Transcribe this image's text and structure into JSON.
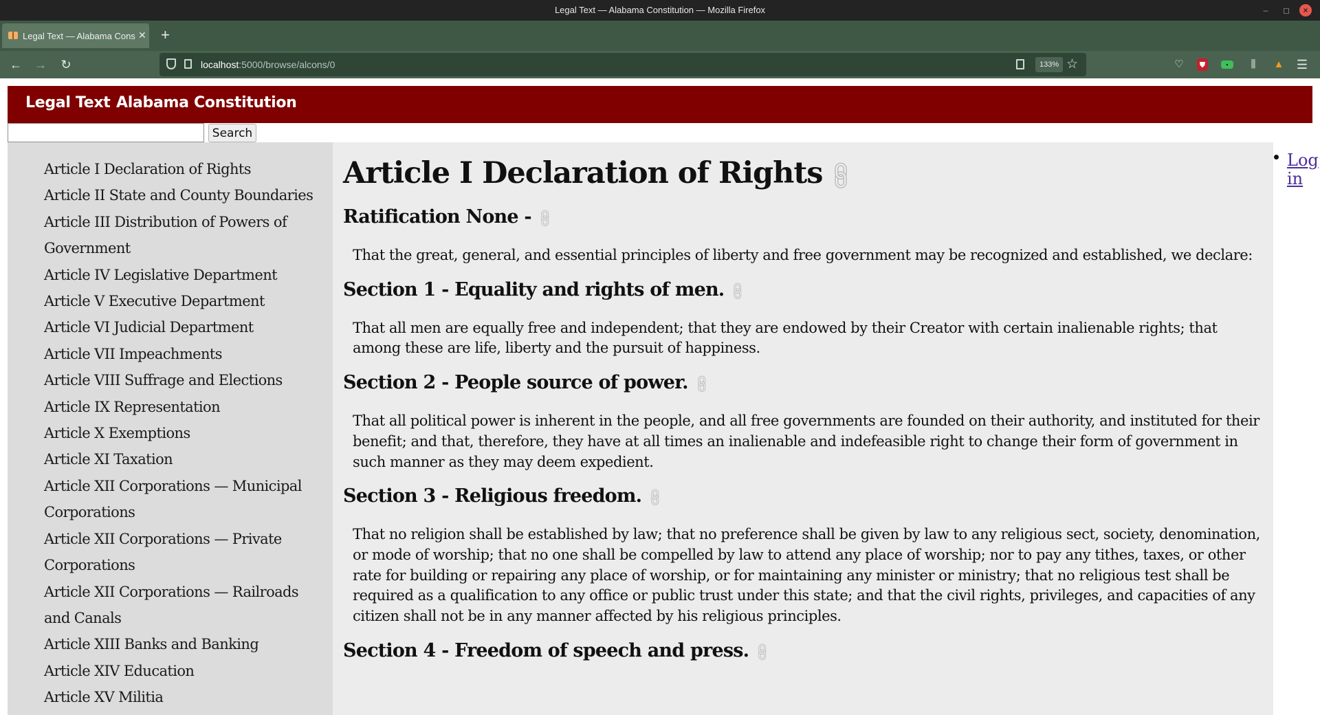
{
  "window": {
    "title": "Legal Text — Alabama Constitution — Mozilla Firefox"
  },
  "tab": {
    "label": "Legal Text — Alabama Cons"
  },
  "urlbar": {
    "host": "localhost",
    "path": ":5000/browse/alcons/0",
    "zoom": "133%"
  },
  "header": {
    "brand": "Legal Text",
    "title": "Alabama Constitution"
  },
  "search": {
    "value": "",
    "button_label": "Search"
  },
  "sidebar": {
    "items": [
      "Article I Declaration of Rights",
      "Article II State and County Boundaries",
      "Article III Distribution of Powers of Government",
      "Article IV Legislative Department",
      "Article V Executive Department",
      "Article VI Judicial Department",
      "Article VII Impeachments",
      "Article VIII Suffrage and Elections",
      "Article IX Representation",
      "Article X Exemptions",
      "Article XI Taxation",
      "Article XII Corporations — Municipal Corporations",
      "Article XII Corporations — Private Corporations",
      "Article XII Corporations — Railroads and Canals",
      "Article XIII Banks and Banking",
      "Article XIV Education",
      "Article XV Militia"
    ]
  },
  "main": {
    "heading": "Article I Declaration of Rights",
    "sections": [
      {
        "title": "Ratification None -",
        "body": "That the great, general, and essential principles of liberty and free government may be recognized and established, we declare:"
      },
      {
        "title": "Section 1 - Equality and rights of men.",
        "body": "That all men are equally free and independent; that they are endowed by their Creator with certain inalienable rights; that among these are life, liberty and the pursuit of happiness."
      },
      {
        "title": "Section 2 - People source of power.",
        "body": "That all political power is inherent in the people, and all free governments are founded on their authority, and instituted for their benefit; and that, therefore, they have at all times an inalienable and indefeasible right to change their form of government in such manner as they may deem expedient."
      },
      {
        "title": "Section 3 - Religious freedom.",
        "body": "That no religion shall be established by law; that no preference shall be given by law to any religious sect, society, denomination, or mode of worship; that no one shall be compelled by law to attend any place of worship; nor to pay any tithes, taxes, or other rate for building or repairing any place of worship, or for maintaining any minister or ministry; that no religious test shall be required as a qualification to any office or public trust under this state; and that the civil rights, privileges, and capacities of any citizen shall not be in any manner affected by his religious principles."
      },
      {
        "title": "Section 4 - Freedom of speech and press.",
        "body": ""
      }
    ]
  },
  "login": {
    "label": "Log in"
  },
  "colors": {
    "header_bg": "#800000",
    "sidebar_bg": "#dcdcdc",
    "main_bg": "#ececec",
    "tabbar_bg": "#3f5845",
    "link": "#4b2c9c"
  },
  "icons": {
    "permalink": "link-icon",
    "login_bullet": "bullet"
  }
}
